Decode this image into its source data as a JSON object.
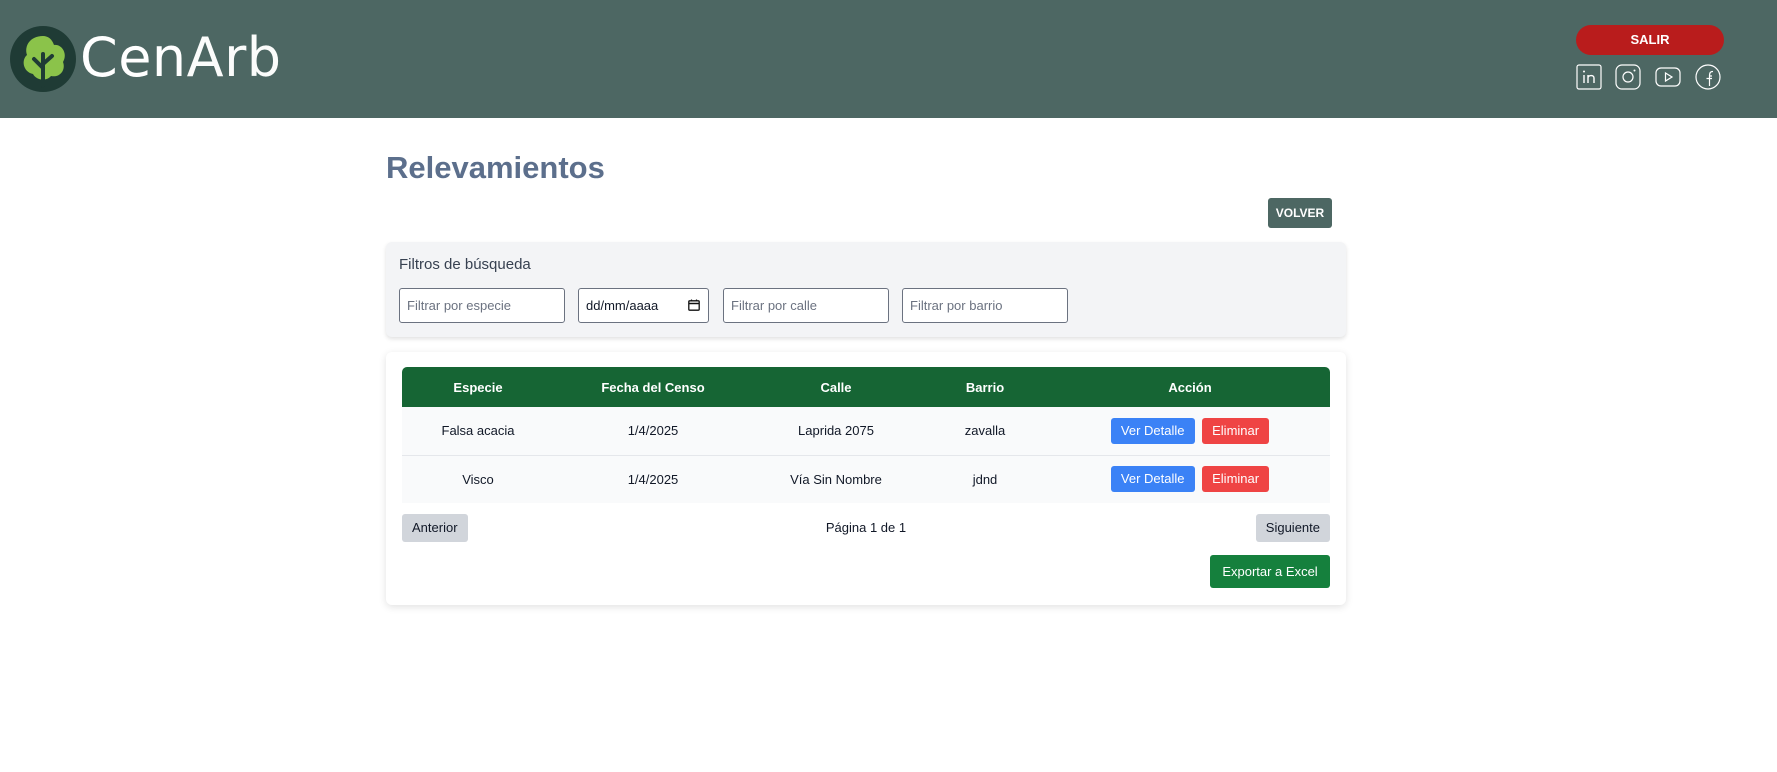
{
  "header": {
    "brand_part1": "Cen",
    "brand_part2": "Arb",
    "logout_label": "SALIR",
    "social_icons": [
      "linkedin-icon",
      "instagram-icon",
      "youtube-icon",
      "facebook-icon"
    ],
    "background_color": "#4d6763"
  },
  "page": {
    "title": "Relevamientos",
    "back_label": "VOLVER"
  },
  "filters": {
    "title": "Filtros de búsqueda",
    "species_placeholder": "Filtrar por especie",
    "date_value": "dd/mm/aaaa",
    "street_placeholder": "Filtrar por calle",
    "neighborhood_placeholder": "Filtrar por barrio"
  },
  "table": {
    "headers": [
      "Especie",
      "Fecha del Censo",
      "Calle",
      "Barrio",
      "Acción"
    ],
    "header_color": "#166534",
    "rows": [
      {
        "especie": "Falsa acacia",
        "fecha": "1/4/2025",
        "calle": "Laprida 2075",
        "barrio": "zavalla"
      },
      {
        "especie": "Visco",
        "fecha": "1/4/2025",
        "calle": "Vía Sin Nombre",
        "barrio": "jdnd"
      }
    ],
    "view_label": "Ver Detalle",
    "delete_label": "Eliminar"
  },
  "pagination": {
    "prev_label": "Anterior",
    "status": "Página 1 de 1",
    "next_label": "Siguiente"
  },
  "export_label": "Exportar a Excel"
}
